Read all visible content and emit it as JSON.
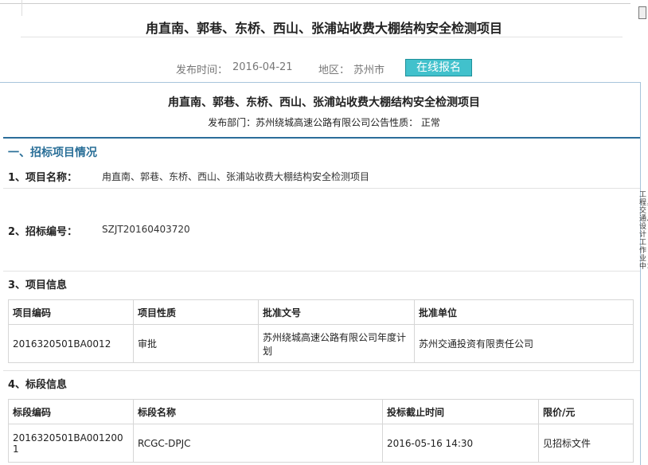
{
  "main_title": "甪直南、郭巷、东桥、西山、张浦站收费大棚结构安全检测项目",
  "meta": {
    "publish_label": "发布时间：",
    "publish_date": "2016-04-21",
    "region_label": "地区：",
    "region": "苏州市",
    "signup_button": "在线报名"
  },
  "notice": {
    "title": "甪直南、郭巷、东桥、西山、张浦站收费大棚结构安全检测项目",
    "dept_line": "发布部门：苏州绕城高速公路有限公司公告性质：  正常"
  },
  "section1": {
    "heading": "一、招标项目情况",
    "item1_label": "1、项目名称：",
    "item1_value": "甪直南、郭巷、东桥、西山、张浦站收费大棚结构安全检测项目",
    "item2_label": "2、招标编号：",
    "item2_value": "SZJT20160403720",
    "item3_label": "3、项目信息",
    "item4_label": "4、标段信息"
  },
  "project_table": {
    "headers": [
      "项目编码",
      "项目性质",
      "批准文号",
      "批准单位"
    ],
    "row": [
      "2016320501BA0012",
      "审批",
      "苏州绕城高速公路有限公司年度计划",
      "苏州交通投资有限责任公司"
    ]
  },
  "lot_table": {
    "headers": [
      "标段编码",
      "标段名称",
      "投标截止时间",
      "限价/元"
    ],
    "row": [
      "2016320501BA0012001",
      "RCGC-DPJC",
      "2016-05-16 14:30",
      "见招标文件"
    ]
  },
  "side_vertical_text": "工程，交通…设计工作业中："
}
